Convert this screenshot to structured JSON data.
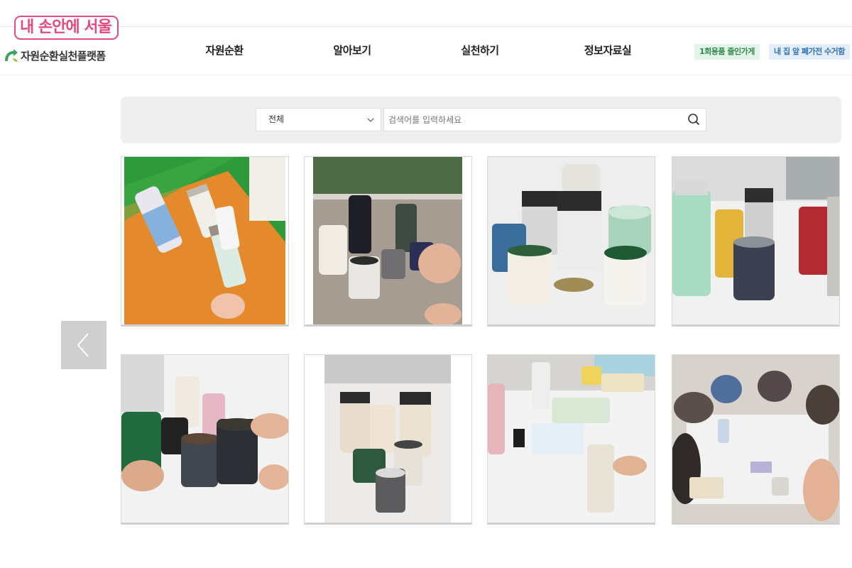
{
  "logo": {
    "bubble_text": "내 손안에 서울",
    "sub_text": "자원순환실천플랫폼"
  },
  "nav": {
    "items": [
      {
        "label": "자원순환"
      },
      {
        "label": "알아보기"
      },
      {
        "label": "실천하기"
      },
      {
        "label": "정보자료실"
      }
    ]
  },
  "tags": {
    "green": "1회용품 줄인가게",
    "blue": "내 집 앞 폐가전 수거함"
  },
  "search": {
    "category_selected": "전체",
    "placeholder": "검색어를 입력하세요"
  },
  "gallery": {
    "photos": [
      {
        "subject": "tumblers-on-green-orange-table"
      },
      {
        "subject": "tumblers-on-windowsill-table"
      },
      {
        "subject": "mugs-and-tumblers-on-white-table"
      },
      {
        "subject": "colorful-tumblers-on-white-table"
      },
      {
        "subject": "hands-holding-mugs-in-circle"
      },
      {
        "subject": "clear-tumblers-on-table"
      },
      {
        "subject": "meeting-table-with-tumbler"
      },
      {
        "subject": "group-meeting-blurred"
      }
    ]
  },
  "colors": {
    "logo_pink": "#e64a7b",
    "logo_green": "#3aa35b",
    "tag_green_bg": "#e3f4e8",
    "tag_blue_bg": "#e3eefa",
    "panel_bg": "#efefef"
  }
}
